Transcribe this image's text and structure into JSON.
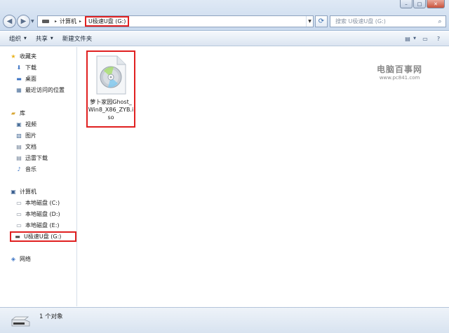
{
  "window": {
    "controls": {
      "minimize": "–",
      "maximize": "□",
      "close": "✕"
    }
  },
  "address": {
    "crumbs": [
      "计算机",
      "U极速U盘 (G:)"
    ],
    "separator": "▸"
  },
  "search": {
    "placeholder": "搜索 U极速U盘 (G:)"
  },
  "toolbar": {
    "organize": "组织",
    "share": "共享",
    "new_folder": "新建文件夹"
  },
  "sidebar": {
    "favorites": {
      "label": "收藏夹",
      "items": [
        "下载",
        "桌面",
        "最近访问的位置"
      ]
    },
    "libraries": {
      "label": "库",
      "items": [
        "视频",
        "图片",
        "文档",
        "迅雷下载",
        "音乐"
      ]
    },
    "computer": {
      "label": "计算机",
      "items": [
        "本地磁盘 (C:)",
        "本地磁盘 (D:)",
        "本地磁盘 (E:)",
        "U极速U盘 (G:)"
      ]
    },
    "network": {
      "label": "网络"
    }
  },
  "files": [
    {
      "name": "萝卜家园Ghost_Win8_X86_ZYB.iso",
      "icon": "disc-image-icon"
    }
  ],
  "watermark": {
    "main": "电脑百事网",
    "sub": "www.pc841.com"
  },
  "status": {
    "count": "1 个对象"
  },
  "colors": {
    "highlight": "#e02020",
    "chrome": "#c9d9ed"
  }
}
